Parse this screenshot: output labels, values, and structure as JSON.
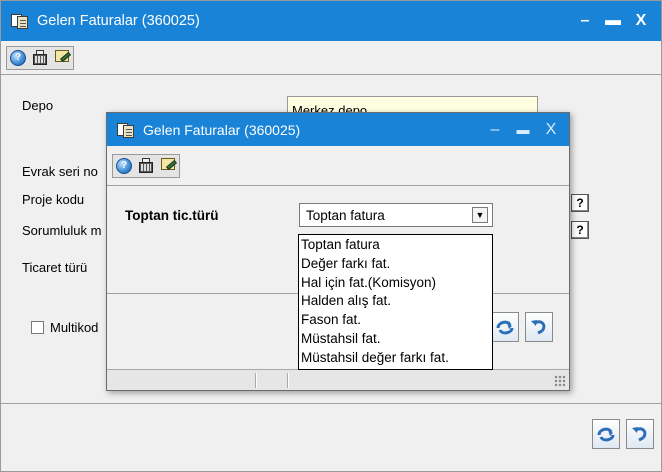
{
  "outer_window": {
    "title": "Gelen Faturalar (360025)",
    "controls": {
      "minimize": "–",
      "maximize": "▬",
      "close": "X"
    },
    "fields": {
      "depo_label": "Depo",
      "depo_value": "Merkez depo",
      "evrak_label": "Evrak seri no",
      "proje_label": "Proje kodu",
      "sorumluluk_label": "Sorumluluk m",
      "ticaret_label": "Ticaret türü",
      "multikod_label": "Multikod"
    },
    "help_button": "?"
  },
  "inner_dialog": {
    "title": "Gelen Faturalar (360025)",
    "controls": {
      "minimize": "–",
      "maximize": "▬",
      "close": "X"
    },
    "field_label": "Toptan tic.türü",
    "selected_value": "Toptan fatura",
    "options": [
      "Toptan fatura",
      "Değer farkı fat.",
      "Hal için fat.(Komisyon)",
      "Halden alış fat.",
      "Fason fat.",
      "Müstahsil fat.",
      "Müstahsil değer farkı fat."
    ]
  },
  "icons": {
    "help": "help-icon",
    "calculator": "calculator-icon",
    "note": "note-edit-icon",
    "confirm": "confirm-icon",
    "undo": "undo-icon"
  },
  "colors": {
    "titlebar": "#1883d7",
    "field_background": "#ffffe1"
  }
}
